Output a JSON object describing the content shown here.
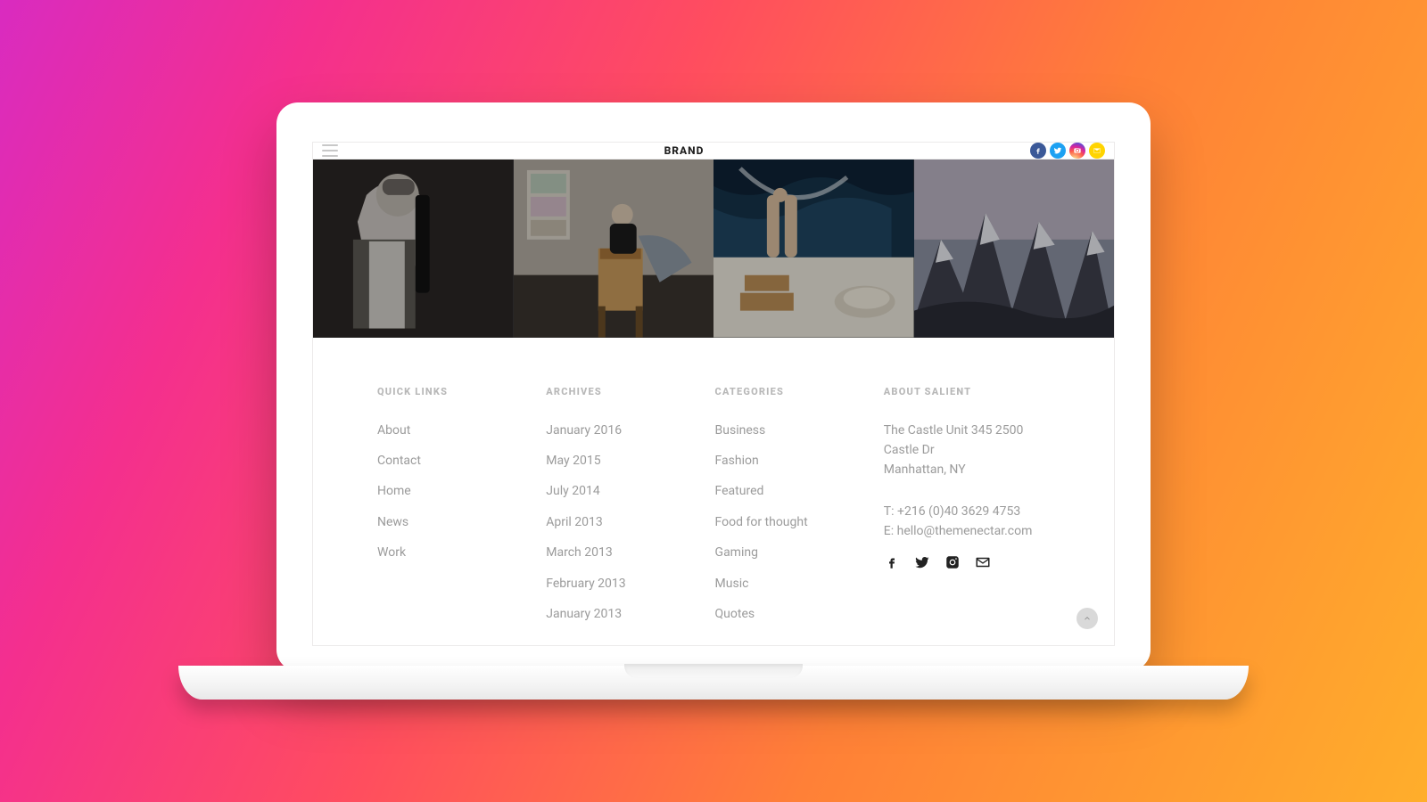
{
  "header": {
    "brand": "BRAND",
    "social": {
      "facebook": "facebook",
      "twitter": "twitter",
      "instagram": "instagram",
      "mail": "mail"
    }
  },
  "gallery": {
    "items": [
      {
        "alt": "Person with camera gear seen from behind"
      },
      {
        "alt": "Person sitting on a chair in a studio room"
      },
      {
        "alt": "Legs up on boat deck over ocean water"
      },
      {
        "alt": "Snowy mountain ridge at dusk"
      }
    ]
  },
  "footer": {
    "quick_links": {
      "heading": "QUICK LINKS",
      "items": [
        "About",
        "Contact",
        "Home",
        "News",
        "Work"
      ]
    },
    "archives": {
      "heading": "ARCHIVES",
      "items": [
        "January 2016",
        "May 2015",
        "July 2014",
        "April 2013",
        "March 2013",
        "February 2013",
        "January 2013"
      ]
    },
    "categories": {
      "heading": "CATEGORIES",
      "items": [
        "Business",
        "Fashion",
        "Featured",
        "Food for thought",
        "Gaming",
        "Music",
        "Quotes"
      ]
    },
    "about": {
      "heading": "ABOUT SALIENT",
      "address": "The Castle Unit 345 2500 Castle Dr\nManhattan, NY",
      "phone": "T: +216 (0)40 3629 4753",
      "email": "E: hello@themenectar.com"
    }
  }
}
